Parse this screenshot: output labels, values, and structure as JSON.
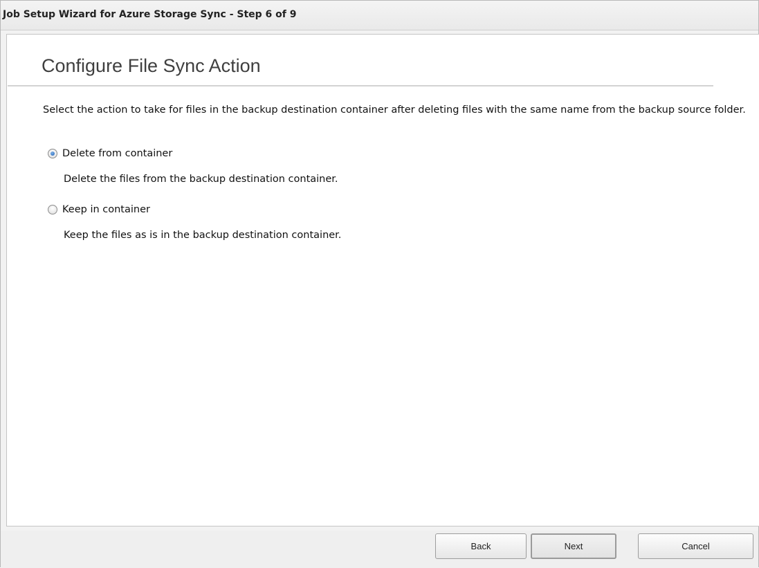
{
  "window": {
    "title": "Job Setup Wizard for Azure Storage Sync - Step 6 of 9"
  },
  "page": {
    "heading": "Configure File Sync Action",
    "description": "Select the action to take for files in the backup destination container after deleting files with the same name from the backup source folder."
  },
  "options": [
    {
      "label": "Delete from container",
      "description": "Delete the files from the backup destination container.",
      "selected": true
    },
    {
      "label": "Keep in container",
      "description": "Keep the files as is in the backup destination container.",
      "selected": false
    }
  ],
  "footer": {
    "back_label": "Back",
    "next_label": "Next",
    "cancel_label": "Cancel"
  },
  "colors": {
    "radio_selected": "#1f5fb5",
    "heading": "#3f3f3f"
  }
}
